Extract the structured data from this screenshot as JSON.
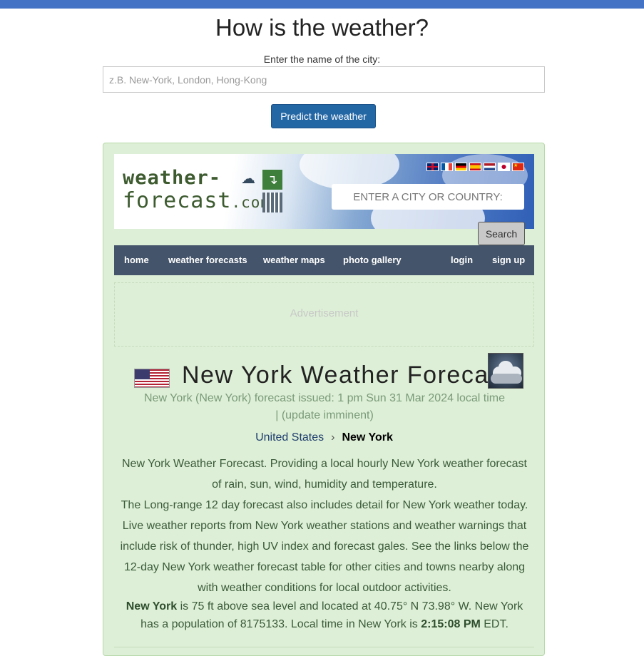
{
  "header": {
    "title": "How is the weather?",
    "city_label": "Enter the name of the city:",
    "city_placeholder": "z.B. New-York, London, Hong-Kong",
    "predict_button": "Predict the weather"
  },
  "widget": {
    "logo_line1": "weather-",
    "logo_line2": "forecast",
    "logo_com": ".com",
    "flags": [
      "uk",
      "fr",
      "de",
      "es",
      "nl",
      "jp",
      "cn"
    ],
    "search_placeholder": "ENTER A CITY OR COUNTRY:",
    "search_button": "Search",
    "nav": {
      "home": "home",
      "forecasts": "weather forecasts",
      "maps": "weather maps",
      "gallery": "photo gallery",
      "login": "login",
      "signup": "sign up"
    },
    "ad_label": "Advertisement",
    "forecast_title": "New York Weather Forecast",
    "issued_line1": "New York (New York) forecast issued: 1 pm Sun 31 Mar 2024 local time",
    "issued_line2": "| (update imminent)",
    "breadcrumb": {
      "country": "United States",
      "separator": "›",
      "city": "New York"
    },
    "description_p1": "New York Weather Forecast. Providing a local hourly New York weather forecast of rain, sun, wind, humidity and temperature.",
    "description_p2": "The Long-range 12 day forecast also includes detail for New York weather today. Live weather reports from New York weather stations and weather warnings that include risk of thunder, high UV index and forecast gales. See the links below the 12-day New York weather forecast table for other cities and towns nearby along with weather conditions for local outdoor activities.",
    "facts": {
      "city": "New York",
      "text1": " is 75 ft above sea level and located at 40.75° N 73.98° W. New York has a population of 8175133. Local time in New York is ",
      "time": "2:15:08 PM",
      "tz": " EDT."
    }
  },
  "colors": {
    "topbar": "#4472c4",
    "button": "#2467a5",
    "panel_bg": "#ddefd6",
    "nav_bg": "#44546a"
  }
}
